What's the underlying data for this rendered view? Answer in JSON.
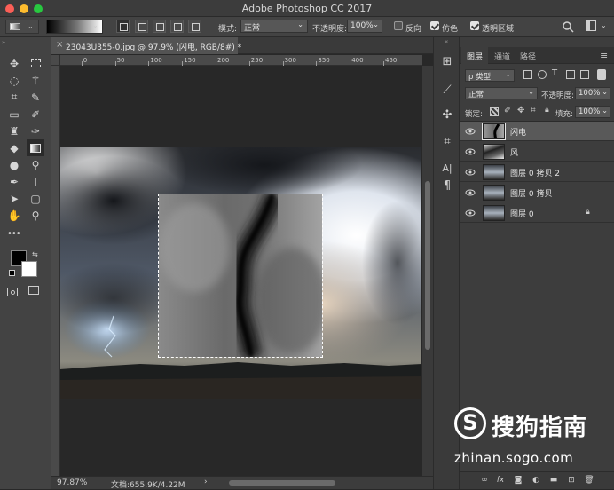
{
  "window": {
    "title": "Adobe Photoshop CC 2017"
  },
  "options_bar": {
    "mode_label": "模式:",
    "mode_value": "正常",
    "opacity_label": "不透明度:",
    "opacity_value": "100%",
    "reverse_label": "反向",
    "reverse_checked": false,
    "dither_label": "仿色",
    "dither_checked": true,
    "transparency_label": "透明区域",
    "transparency_checked": true
  },
  "document": {
    "tab_title": "23043U355-0.jpg @ 97.9% (闪电, RGB/8#) *",
    "close_glyph": "×"
  },
  "rulers": {
    "top_ticks": [
      "50",
      "0",
      "50",
      "100",
      "150",
      "200",
      "250",
      "300",
      "350",
      "400",
      "450",
      "500",
      "550"
    ]
  },
  "status_bar": {
    "zoom": "97.87%",
    "doc_info": "文档:655.9K/4.22M",
    "arrow": "›"
  },
  "toolbar": {
    "tools": [
      "move-tool",
      "marquee-tool",
      "lasso-tool",
      "magic-wand-tool",
      "crop-tool",
      "eyedropper-tool",
      "healing-brush-tool",
      "brush-tool",
      "clone-stamp-tool",
      "history-brush-tool",
      "eraser-tool",
      "gradient-tool",
      "blur-tool",
      "dodge-tool",
      "pen-tool",
      "type-tool",
      "path-selection-tool",
      "rectangle-tool",
      "hand-tool",
      "zoom-tool"
    ],
    "more": "•••",
    "foreground_color": "#000000",
    "background_color": "#ffffff"
  },
  "layers_panel": {
    "tabs": [
      "图层",
      "通道",
      "路径"
    ],
    "active_tab": "图层",
    "menu_glyph": "≡",
    "filter_label": "ρ 类型",
    "blend_mode": "正常",
    "opacity_label": "不透明度:",
    "opacity_value": "100%",
    "lock_label": "锁定:",
    "fill_label": "填充:",
    "fill_value": "100%",
    "layers": [
      {
        "name": "闪电",
        "selected": true,
        "locked": false
      },
      {
        "name": "风",
        "selected": false,
        "locked": false
      },
      {
        "name": "图层 0 拷贝 2",
        "selected": false,
        "locked": false
      },
      {
        "name": "图层 0 拷贝",
        "selected": false,
        "locked": false
      },
      {
        "name": "图层 0",
        "selected": false,
        "locked": true
      }
    ],
    "footer": [
      "link-icon",
      "fx",
      "mask-icon",
      "adjustment-icon",
      "folder-icon",
      "new-layer-icon",
      "trash-icon"
    ],
    "footer_fx": "fx"
  },
  "watermark": {
    "brand": "搜狗指南",
    "url": "zhinan.sogo.com",
    "logo_letter": "S"
  }
}
